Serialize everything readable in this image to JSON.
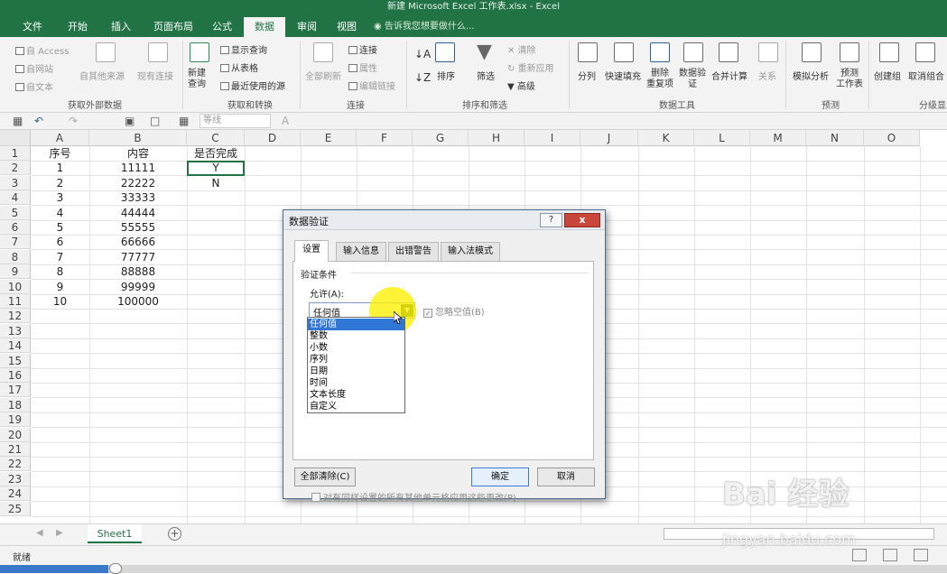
{
  "window": {
    "title": "新建 Microsoft Excel 工作表.xlsx - Excel"
  },
  "tabs": [
    "文件",
    "开始",
    "插入",
    "页面布局",
    "公式",
    "数据",
    "审阅",
    "视图"
  ],
  "active_tab": "数据",
  "tell_me": "告诉我您想要做什么...",
  "ribbon": {
    "get_external": {
      "access": "自 Access",
      "web": "自网站",
      "text": "自文本",
      "other": "自其他来源",
      "existing": "现有连接",
      "label": "获取外部数据"
    },
    "transform": {
      "new_query": "新建\n查询",
      "show_query": "显示查询",
      "from_table": "从表格",
      "recent": "最近使用的源",
      "label": "获取和转换"
    },
    "connections": {
      "refresh": "全部刷新",
      "conn": "连接",
      "props": "属性",
      "edit_links": "编辑链接",
      "label": "连接"
    },
    "sort_filter": {
      "sort": "排序",
      "filter": "筛选",
      "clear": "清除",
      "reapply": "重新应用",
      "advanced": "高级",
      "label": "排序和筛选"
    },
    "data_tools": {
      "split": "分列",
      "flash_fill": "快速填充",
      "remove_dup": "删除\n重复项",
      "validation": "数据验\n证",
      "consolidate": "合并计算",
      "relations": "关系",
      "label": "数据工具"
    },
    "forecast": {
      "whatif": "模拟分析",
      "sheet": "预测\n工作表",
      "label": "预测"
    },
    "outline": {
      "group": "创建组",
      "ungroup": "取消组合",
      "label": "分级显示"
    }
  },
  "qat": {
    "font_name": "等线"
  },
  "columns": [
    "A",
    "B",
    "C",
    "D",
    "E",
    "F",
    "G",
    "H",
    "I",
    "J",
    "K",
    "L",
    "M",
    "N",
    "O"
  ],
  "rows": [
    "1",
    "2",
    "3",
    "4",
    "5",
    "6",
    "7",
    "8",
    "9",
    "10",
    "11",
    "12",
    "13",
    "14",
    "15",
    "16",
    "17",
    "18",
    "19",
    "20",
    "21",
    "22",
    "23",
    "24",
    "25"
  ],
  "cells": [
    [
      "序号",
      "内容",
      "是否完成"
    ],
    [
      "1",
      "11111",
      "Y"
    ],
    [
      "2",
      "22222",
      "N"
    ],
    [
      "3",
      "33333",
      ""
    ],
    [
      "4",
      "44444",
      ""
    ],
    [
      "5",
      "55555",
      ""
    ],
    [
      "6",
      "66666",
      ""
    ],
    [
      "7",
      "77777",
      ""
    ],
    [
      "8",
      "88888",
      ""
    ],
    [
      "9",
      "99999",
      ""
    ],
    [
      "10",
      "100000",
      ""
    ]
  ],
  "sheet": {
    "name": "Sheet1",
    "add": "+"
  },
  "status": {
    "ready": "就绪"
  },
  "dialog": {
    "title": "数据验证",
    "help": "?",
    "close": "x",
    "tabs": [
      "设置",
      "输入信息",
      "出错警告",
      "输入法模式"
    ],
    "active_tab": "设置",
    "criteria_label": "验证条件",
    "allow_label": "允许(A):",
    "allow_value": "任何值",
    "ignore_blank": "忽略空值(B)",
    "options": [
      "任何值",
      "整数",
      "小数",
      "序列",
      "日期",
      "时间",
      "文本长度",
      "自定义"
    ],
    "apply_all": "对有同样设置的所有其他单元格应用这些更改(P)",
    "clear_all": "全部清除(C)",
    "ok": "确定",
    "cancel": "取消"
  },
  "watermark": {
    "brand": "Bai 经验",
    "url": "jingyan.baidu.com"
  }
}
